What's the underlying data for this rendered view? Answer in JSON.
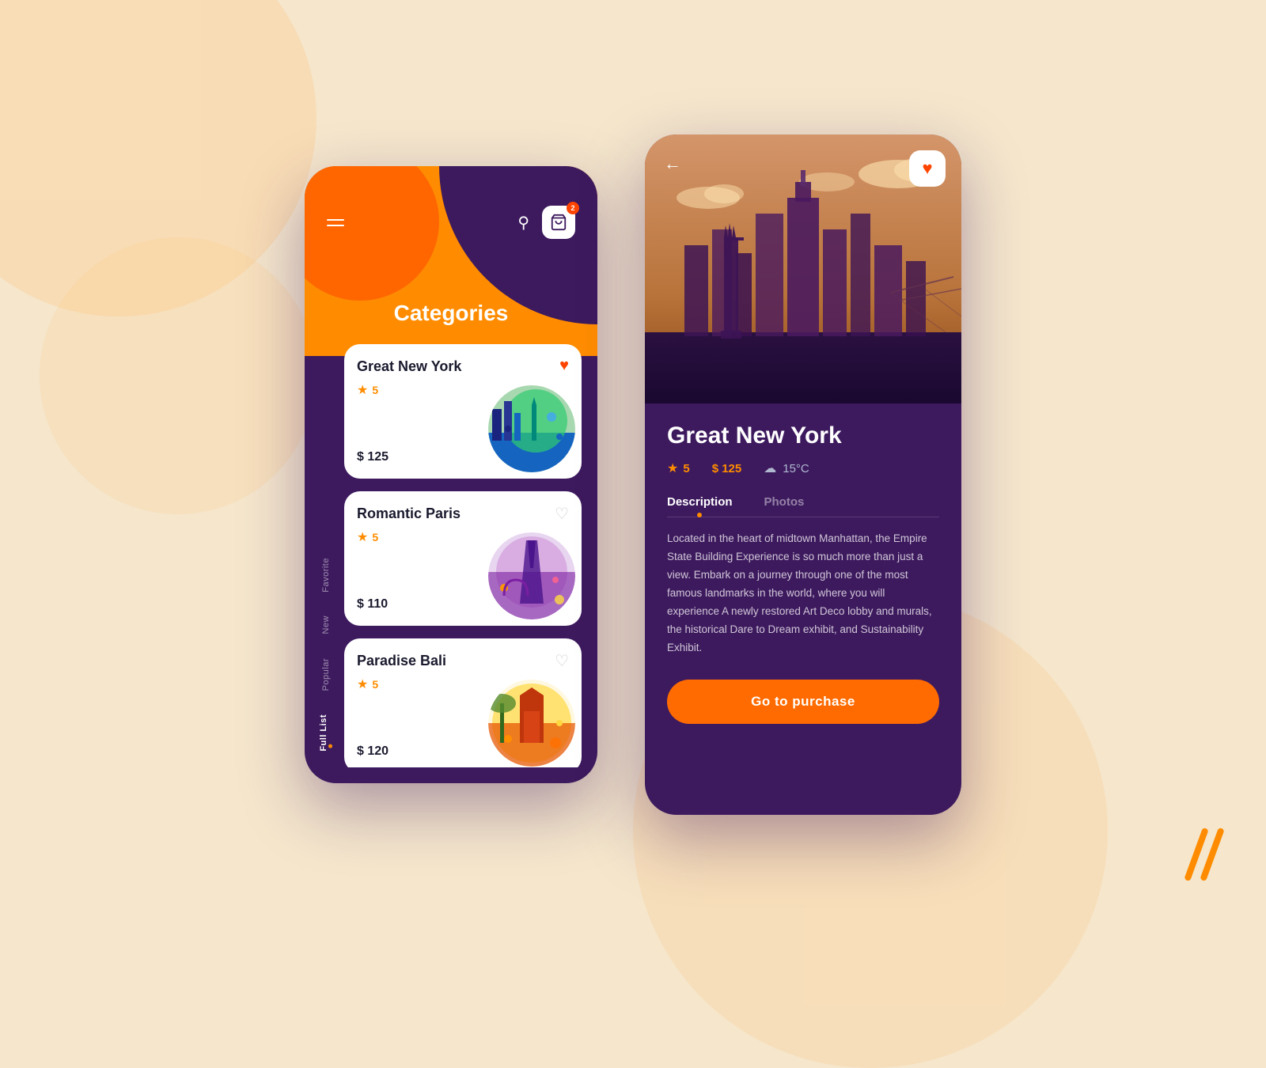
{
  "background": {
    "color": "#f5e6cc"
  },
  "left_phone": {
    "title": "Categories",
    "nav_items": [
      {
        "label": "Favorite",
        "active": false
      },
      {
        "label": "New",
        "active": false
      },
      {
        "label": "Popular",
        "active": false
      },
      {
        "label": "Full List",
        "active": true
      }
    ],
    "cards": [
      {
        "id": "ny",
        "title": "Great New York",
        "rating": "5",
        "price": "$ 125",
        "heart": "filled",
        "emoji": "🗽"
      },
      {
        "id": "paris",
        "title": "Romantic Paris",
        "rating": "5",
        "price": "$ 110",
        "heart": "outline",
        "emoji": "🗼"
      },
      {
        "id": "bali",
        "title": "Paradise Bali",
        "rating": "5",
        "price": "$ 120",
        "heart": "outline",
        "emoji": "🏯"
      }
    ]
  },
  "right_phone": {
    "title": "Great New York",
    "rating": "5",
    "price": "$ 125",
    "temperature": "15°C",
    "tabs": [
      {
        "label": "Description",
        "active": true
      },
      {
        "label": "Photos",
        "active": false
      }
    ],
    "description": "Located in the heart of midtown Manhattan, the Empire State Building Experience is so much more than just a view. Embark on a journey through one of the most famous landmarks in the world, where you will experience A newly restored Art Deco lobby and murals, the historical Dare to Dream exhibit, and Sustainability Exhibit.",
    "purchase_button": "Go to purchase"
  }
}
